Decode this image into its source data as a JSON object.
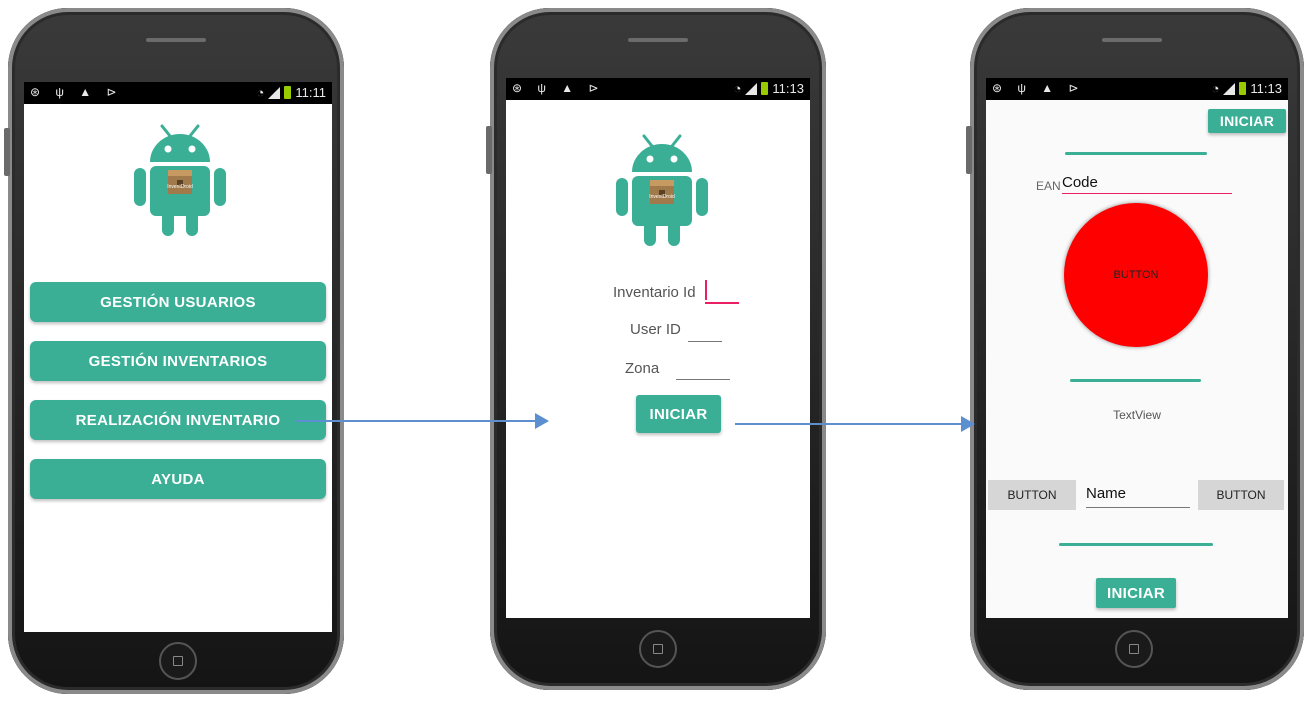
{
  "status": {
    "time1": "11:11",
    "time2": "11:13",
    "time3": "11:13",
    "left_icons": "⊛ ψ ▲ ⊳"
  },
  "screen1": {
    "logo_text": "InventDroid",
    "buttons": [
      "GESTIÓN USUARIOS",
      "GESTIÓN INVENTARIOS",
      "REALIZACIÓN INVENTARIO",
      "AYUDA"
    ]
  },
  "screen2": {
    "logo_text": "InventDroid",
    "inventario_label": "Inventario Id",
    "user_label": "User ID",
    "zona_label": "Zona",
    "start_button": "INICIAR"
  },
  "screen3": {
    "top_button": "INICIAR",
    "ean_label": "EAN",
    "code_value": "Code",
    "circle_button": "BUTTON",
    "textview": "TextView",
    "left_button": "BUTTON",
    "name_value": "Name",
    "right_button": "BUTTON",
    "bottom_button": "INICIAR"
  },
  "colors": {
    "teal": "#3aaf96",
    "red": "#ff0000",
    "accent_pink": "#e91e63",
    "arrow": "#5b8fd0"
  }
}
